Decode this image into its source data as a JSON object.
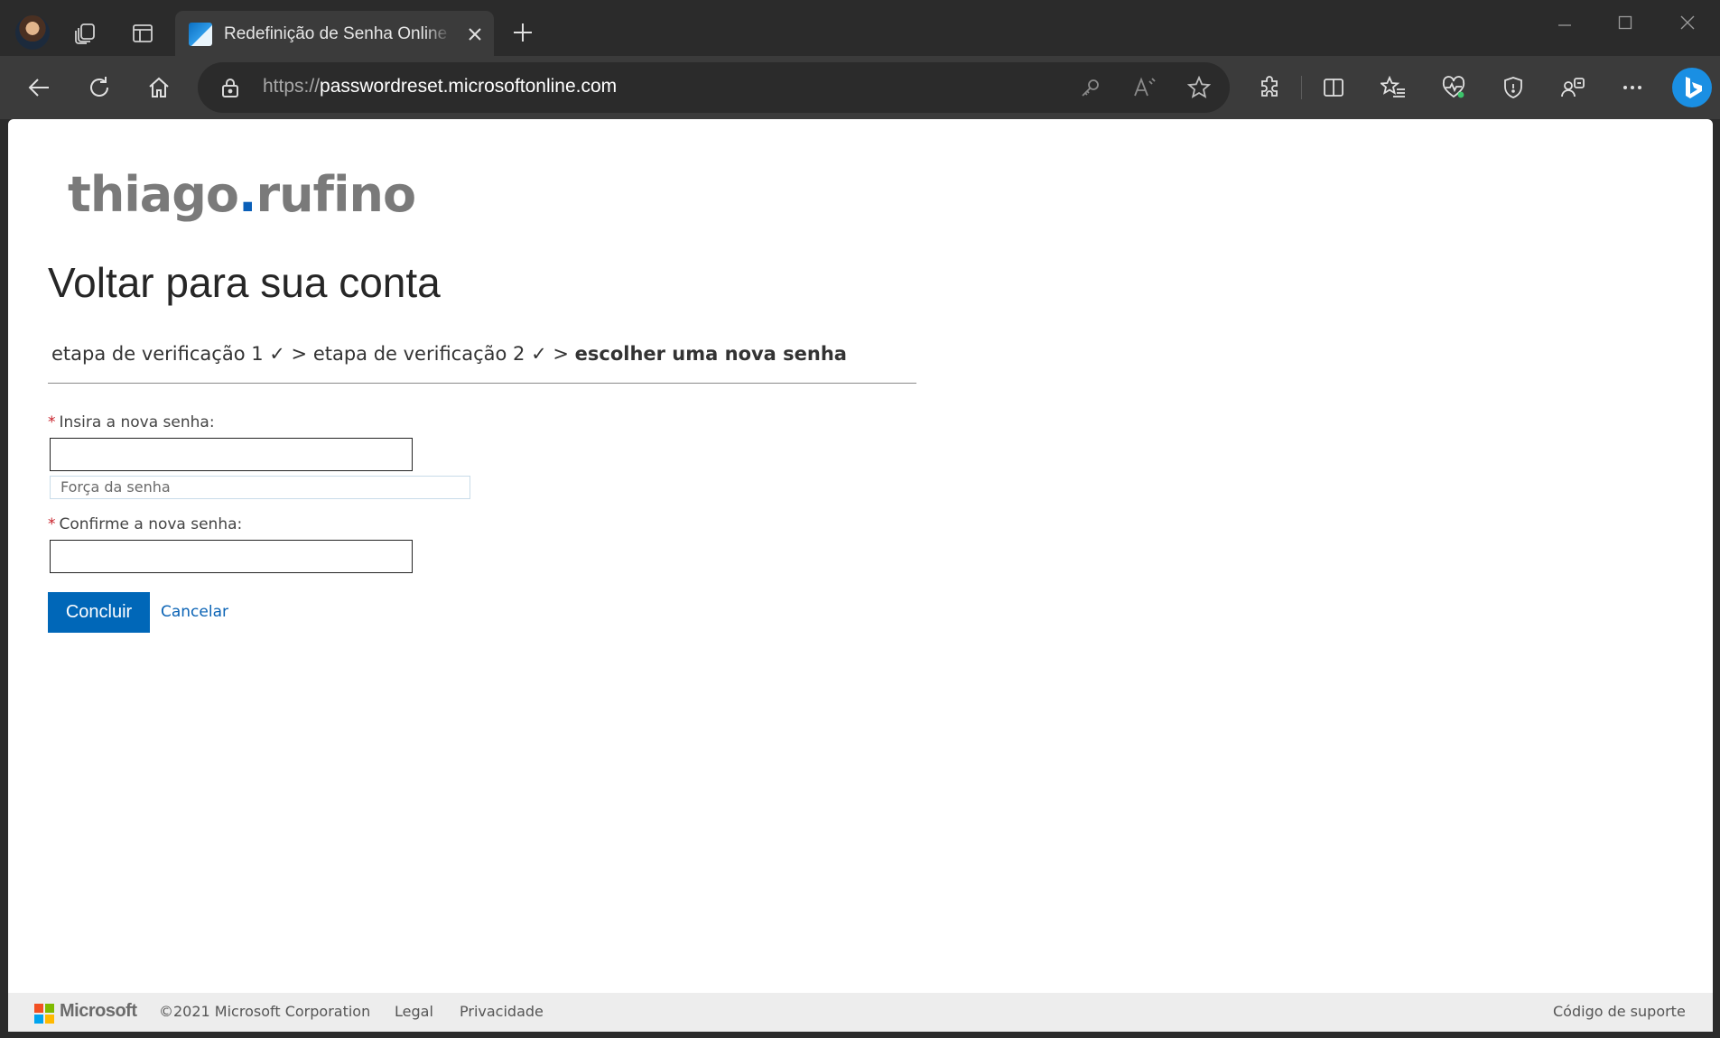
{
  "browser": {
    "tab": {
      "title": "Redefinição de Senha Online da Microsoft",
      "close_label": "✕"
    },
    "new_tab_label": "+",
    "address": {
      "protocol": "https://",
      "domain": "passwordreset.microsoftonline.com"
    }
  },
  "page": {
    "logo": {
      "left": "thiago",
      "dot": ".",
      "right": "rufino"
    },
    "title": "Voltar para sua conta",
    "steps": {
      "step1": "etapa de verificação 1 ✓",
      "sep1": " > ",
      "step2": "etapa de verificação 2 ✓",
      "sep2": " > ",
      "current": "escolher uma nova senha"
    },
    "form": {
      "required_mark": "*",
      "new_password_label": "Insira a nova senha:",
      "new_password_value": "",
      "strength_label": "Força da senha",
      "confirm_password_label": "Confirme a nova senha:",
      "confirm_password_value": "",
      "submit_label": "Concluir",
      "cancel_label": "Cancelar"
    },
    "footer": {
      "brand": "Microsoft",
      "copyright": "©2021 Microsoft Corporation",
      "legal": "Legal",
      "privacy": "Privacidade",
      "support_code": "Código de suporte"
    }
  },
  "colors": {
    "accent": "#0067b8",
    "link": "#0a63b5",
    "required": "#c8202a",
    "logo_dot": "#0a5fb8",
    "ms_red": "#f25022",
    "ms_green": "#7fba00",
    "ms_blue": "#00a4ef",
    "ms_yellow": "#ffb900"
  }
}
